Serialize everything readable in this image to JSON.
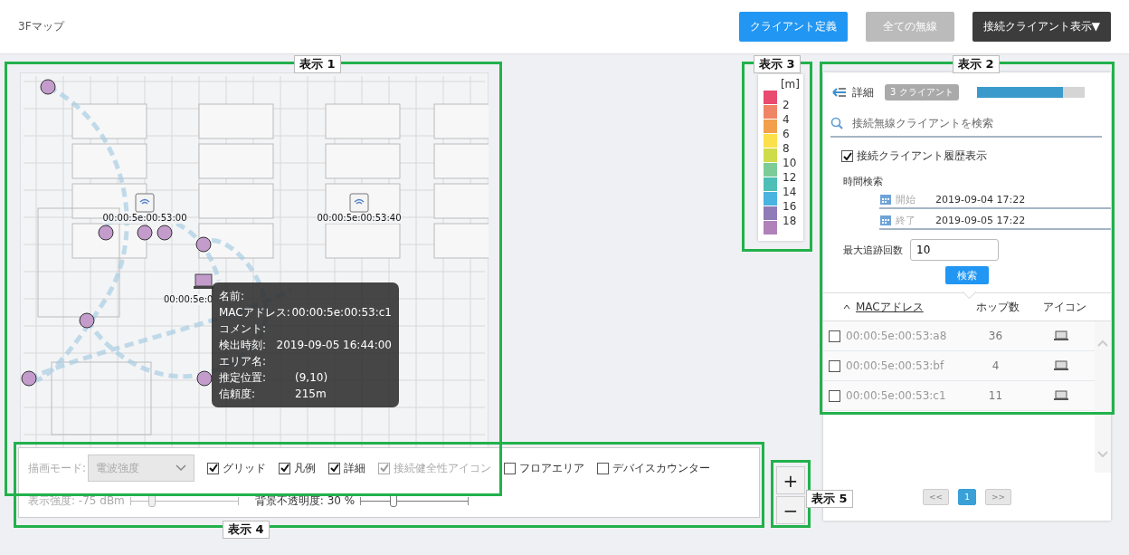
{
  "header": {
    "title": "3Fマップ",
    "buttons": [
      {
        "label": "クライアント定義",
        "kind": "primary"
      },
      {
        "label": "全ての無線",
        "kind": "disabled"
      },
      {
        "label": "接続クライアント表示",
        "kind": "dropdown",
        "caret": "▼"
      }
    ]
  },
  "map": {
    "annotation": "表示 1",
    "devices": [
      {
        "kind": "access-point",
        "label": "00:00:5e:00:53:00"
      },
      {
        "kind": "access-point",
        "label": "00:00:5e:00:53:40"
      },
      {
        "kind": "laptop",
        "label": "00:00:5e:0"
      }
    ],
    "tooltip": [
      {
        "label": "名前:"
      },
      {
        "label": "MACアドレス:",
        "value": "00:00:5e:00:53:c1"
      },
      {
        "label": "コメント:"
      },
      {
        "label": "検出時刻:",
        "value": "2019-09-05 16:44:00"
      },
      {
        "label": "エリア名:"
      },
      {
        "label": "推定位置:",
        "value": "(9,10)"
      },
      {
        "label": "信頼度:",
        "value": "215m"
      }
    ]
  },
  "legend": {
    "annotation": "表示 3",
    "unit": "[m]",
    "items": [
      {
        "label": "2",
        "color": "#e94a70"
      },
      {
        "label": "4",
        "color": "#ef8466"
      },
      {
        "label": "6",
        "color": "#f2a04c"
      },
      {
        "label": "8",
        "color": "#fbe04b"
      },
      {
        "label": "10",
        "color": "#cfdc4a"
      },
      {
        "label": "12",
        "color": "#7dcc98"
      },
      {
        "label": "14",
        "color": "#4dbfb6"
      },
      {
        "label": "16",
        "color": "#4ab3e0"
      },
      {
        "label": "18",
        "color": "#8f7bb7"
      },
      {
        "color": "#b182b9"
      }
    ]
  },
  "panel": {
    "annotation": "表示 2",
    "title": "詳細",
    "badge": "3 クライアント",
    "progress": {
      "level": 0.8
    },
    "search": {
      "placeholder": "接続無線クライアントを検索"
    },
    "history": {
      "label": "接続クライアント履歴表示",
      "checked": true
    },
    "time_label": "時間検索",
    "time_fields": [
      {
        "label": "開始",
        "value": "2019-09-04 17:22"
      },
      {
        "label": "終了",
        "value": "2019-09-05 17:22"
      }
    ],
    "max_label": "最大追跡回数",
    "max_value": "10",
    "search_button": "検索",
    "columns": [
      "MACアドレス",
      "ホップ数",
      "アイコン"
    ],
    "rows": [
      {
        "mac": "00:00:5e:00:53:a8",
        "hops": "36",
        "checked": false
      },
      {
        "mac": "00:00:5e:00:53:bf",
        "hops": "4",
        "checked": false
      },
      {
        "mac": "00:00:5e:00:53:c1",
        "hops": "11",
        "checked": false
      }
    ],
    "pages": [
      {
        "label": "<<",
        "selected": false
      },
      {
        "label": "1",
        "selected": true
      },
      {
        "label": ">>",
        "selected": false
      }
    ]
  },
  "controls": {
    "annotation": "表示 4",
    "mode_label": "描画モード:",
    "mode_value": "電波強度",
    "checks": [
      {
        "label": "グリッド",
        "checked": true,
        "disabled": false
      },
      {
        "label": "凡例",
        "checked": true,
        "disabled": false
      },
      {
        "label": "詳細",
        "checked": true,
        "disabled": false
      },
      {
        "label": "接続健全性アイコン",
        "checked": true,
        "disabled": true
      },
      {
        "label": "フロアエリア",
        "checked": false,
        "disabled": false
      },
      {
        "label": "デバイスカウンター",
        "checked": false,
        "disabled": false
      }
    ],
    "sliders": [
      {
        "label": "表示強度: -75 dBm",
        "level": 0.2,
        "disabled": true
      },
      {
        "label": "背景不透明度: 30 %",
        "level": 0.3,
        "disabled": false
      }
    ]
  },
  "zoom": {
    "annotation": "表示 5",
    "buttons": [
      "+",
      "−"
    ]
  }
}
